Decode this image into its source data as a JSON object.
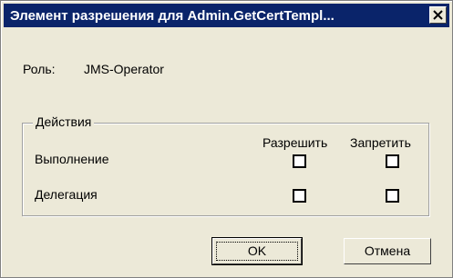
{
  "window": {
    "title": "Элемент разрешения для Admin.GetCertTempl...",
    "close_icon": "close-icon",
    "accent_color": "#0a246a",
    "face_color": "#ece9d8"
  },
  "role": {
    "label": "Роль:",
    "value": "JMS-Operator"
  },
  "actions": {
    "group_label": "Действия",
    "columns": [
      "Разрешить",
      "Запретить"
    ],
    "rows": [
      {
        "label": "Выполнение",
        "allow": false,
        "deny": false
      },
      {
        "label": "Делегация",
        "allow": false,
        "deny": false
      }
    ]
  },
  "buttons": {
    "ok_label": "OK",
    "cancel_label": "Отмена"
  }
}
